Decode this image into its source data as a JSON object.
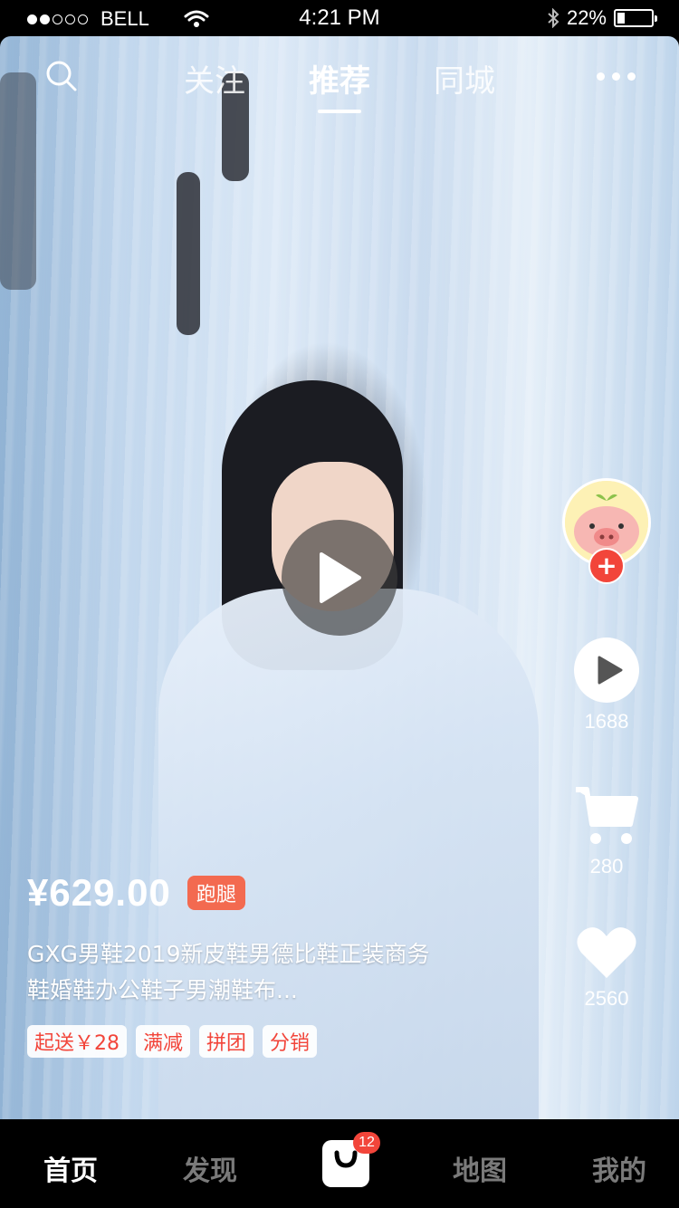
{
  "status_bar": {
    "carrier": "BELL",
    "time": "4:21 PM",
    "battery": "22%",
    "battery_level": 0.22
  },
  "top_nav": {
    "tabs": [
      {
        "label": "关注",
        "active": false
      },
      {
        "label": "推荐",
        "active": true
      },
      {
        "label": "同城",
        "active": false
      }
    ]
  },
  "rail": {
    "plays": "1688",
    "cart": "280",
    "likes": "2560"
  },
  "product": {
    "price": "¥629.00",
    "badge": "跑腿",
    "title_line1": "GXG男鞋2019新皮鞋男德比鞋正装商务",
    "title_line2": "鞋婚鞋办公鞋子男潮鞋布...",
    "tags": [
      "起送￥28",
      "满减",
      "拼团",
      "分销"
    ]
  },
  "bottom_nav": {
    "items": [
      "首页",
      "发现",
      "地图",
      "我的"
    ],
    "cart_badge": "12"
  },
  "colors": {
    "accent_red": "#f2453a",
    "badge_orange": "#f36a50"
  }
}
